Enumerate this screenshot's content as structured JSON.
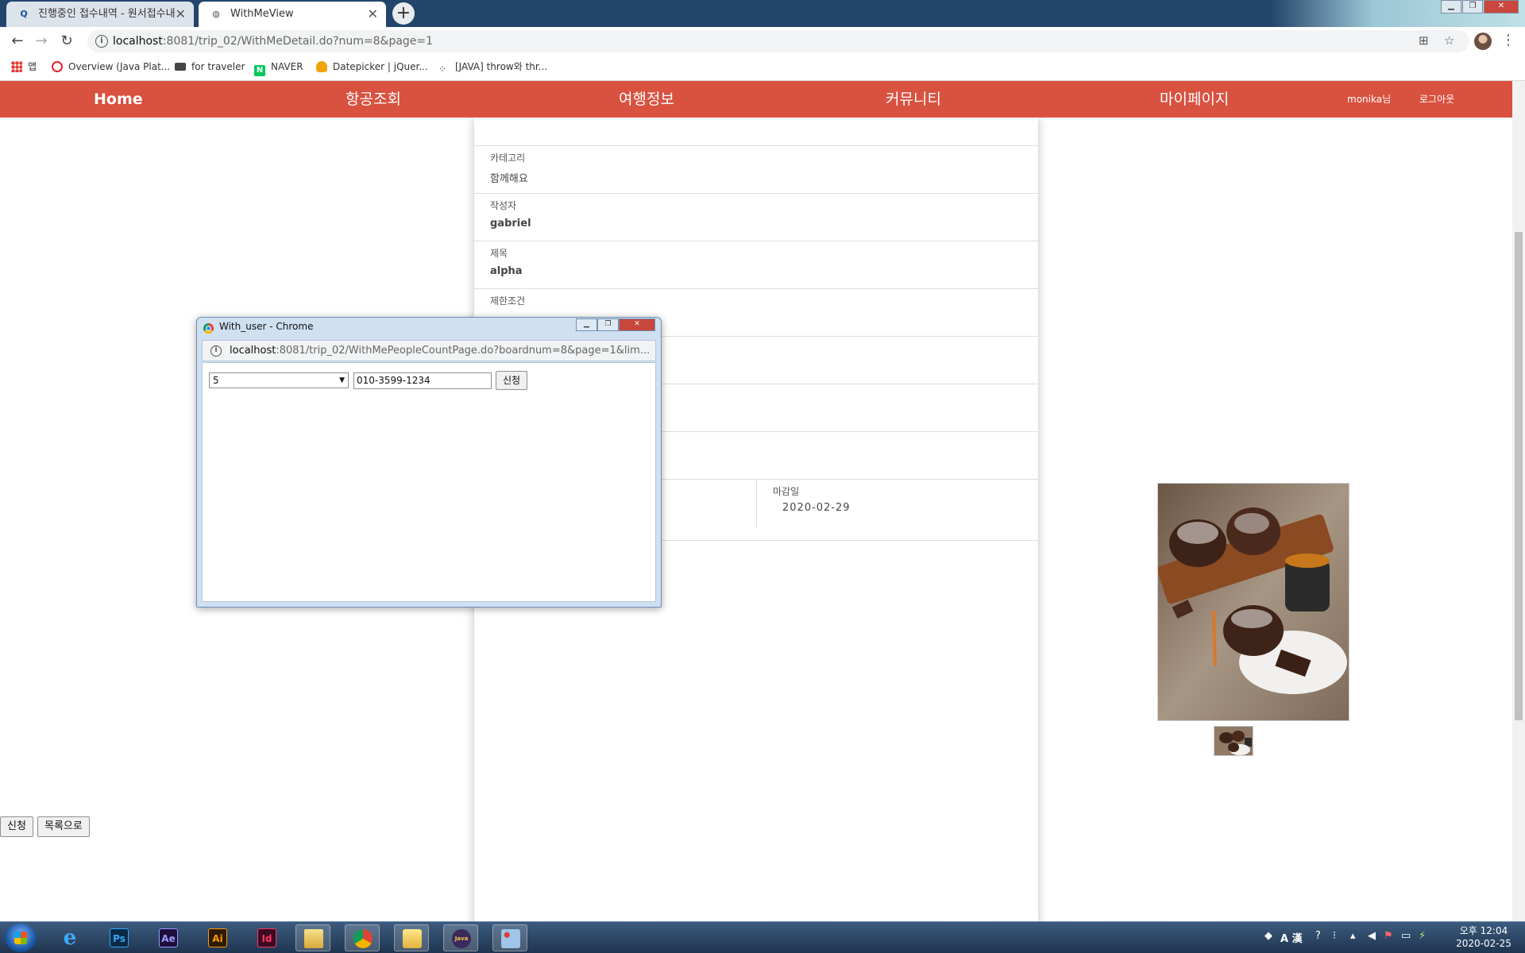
{
  "browser": {
    "tabs": [
      {
        "title": "진행중인 접수내역 - 원서접수내",
        "favicon": "Q",
        "active": false
      },
      {
        "title": "WithMeView",
        "favicon": "globe",
        "active": true
      }
    ],
    "new_tab": "+",
    "address": {
      "host": "localhost",
      "path": ":8081/trip_02/WithMeDetail.do?num=8&page=1"
    },
    "bookmarks": [
      {
        "label": "앱",
        "icon": "apps-icon"
      },
      {
        "label": "Overview (Java Plat...",
        "icon": "oracle-icon",
        "color": "#e3242b"
      },
      {
        "label": "for traveler",
        "icon": "bookmark-icon",
        "color": "#444444"
      },
      {
        "label": "NAVER",
        "icon": "naver-icon",
        "color": "#03c75a"
      },
      {
        "label": "Datepicker | jQuer...",
        "icon": "jquery-icon",
        "color": "#f0a30a"
      },
      {
        "label": "[JAVA] throw와 thr...",
        "icon": "tistory-icon",
        "color": "#333333"
      }
    ]
  },
  "site_nav": {
    "items": [
      "Home",
      "항공조회",
      "여행정보",
      "커뮤니티",
      "마이페이지"
    ],
    "user": "monika님",
    "logout": "로그아웃",
    "color": "#d9513f"
  },
  "detail": {
    "fields": [
      {
        "label": "카테고리",
        "value": "함께해요"
      },
      {
        "label": "작성자",
        "value": "gabriel"
      },
      {
        "label": "제목",
        "value": "alpha"
      },
      {
        "label": "제한조건",
        "value": ""
      },
      {
        "label": "",
        "value": ""
      },
      {
        "label": "",
        "value": ""
      },
      {
        "label": "",
        "value": ""
      }
    ],
    "deadline_label": "마감일",
    "deadline_value": "2020-02-29"
  },
  "buttons": {
    "apply": "신청",
    "list": "목록으로"
  },
  "popup": {
    "title": "With_user - Chrome",
    "address": {
      "host": "localhost",
      "path": ":8081/trip_02/WithMePeopleCountPage.do?boardnum=8&page=1&lim..."
    },
    "select_value": "5",
    "phone_value": "010-3599-1234",
    "submit": "신청"
  },
  "taskbar": {
    "apps": [
      {
        "name": "internet-explorer-icon",
        "label": "e"
      },
      {
        "name": "photoshop-icon",
        "label": "Ps"
      },
      {
        "name": "after-effects-icon",
        "label": "Ae"
      },
      {
        "name": "illustrator-icon",
        "label": "Ai"
      },
      {
        "name": "indesign-icon",
        "label": "Id"
      },
      {
        "name": "file-explorer-icon",
        "label": ""
      },
      {
        "name": "chrome-icon",
        "label": ""
      },
      {
        "name": "folder-icon",
        "label": ""
      },
      {
        "name": "java-ee-icon",
        "label": "Java EE"
      },
      {
        "name": "paint-icon",
        "label": ""
      }
    ],
    "ime": "A 漢",
    "clock_time": "오후 12:04",
    "clock_date": "2020-02-25"
  }
}
